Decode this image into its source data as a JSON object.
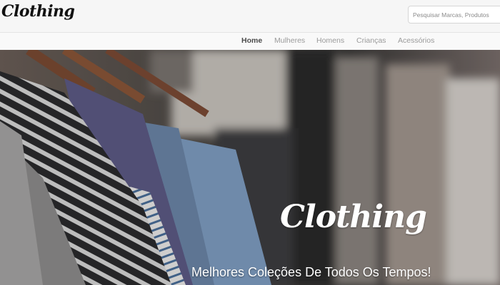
{
  "header": {
    "logo_text": "Clothing",
    "search_placeholder": "Pesquisar Marcas, Produtos"
  },
  "nav": {
    "items": [
      {
        "label": "Home",
        "active": true
      },
      {
        "label": "Mulheres",
        "active": false
      },
      {
        "label": "Homens",
        "active": false
      },
      {
        "label": "Crianças",
        "active": false
      },
      {
        "label": "Acessórios",
        "active": false
      }
    ]
  },
  "hero": {
    "logo_text": "Clothing",
    "tagline": "Melhores Coleções De Todos Os Tempos!"
  },
  "colors": {
    "header_bg": "#f6f6f6",
    "nav_active": "#4a4a4a",
    "nav_inactive": "#9a9a9a",
    "hero_text": "#ffffff"
  }
}
